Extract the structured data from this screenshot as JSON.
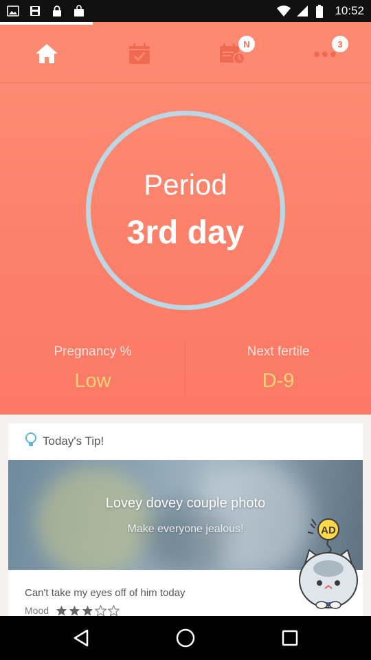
{
  "status_bar": {
    "time": "10:52",
    "left_icons": [
      "image-icon",
      "save-icon",
      "lock-icon",
      "bag-icon"
    ],
    "right_icons": [
      "wifi-icon",
      "signal-icon",
      "battery-icon"
    ]
  },
  "tabs": [
    {
      "name": "home",
      "icon": "home-icon",
      "active": true,
      "badge": ""
    },
    {
      "name": "calendar",
      "icon": "calendar-check-icon",
      "active": false,
      "badge": ""
    },
    {
      "name": "schedule",
      "icon": "calendar-clock-icon",
      "active": false,
      "badge": "N"
    },
    {
      "name": "more",
      "icon": "more-icon",
      "active": false,
      "badge": "3"
    }
  ],
  "hero": {
    "status_title": "Period",
    "status_day": "3rd day",
    "pregnancy_label": "Pregnancy %",
    "pregnancy_value": "Low",
    "fertile_label": "Next fertile",
    "fertile_value": "D-9"
  },
  "tip": {
    "header": "Today's Tip!",
    "photo_title": "Lovey dovey couple photo",
    "photo_subtitle": "Make everyone jealous!",
    "post_text": "Can't take my eyes off of him today",
    "mood_label": "Mood",
    "mood_rating": 3,
    "mood_max": 5,
    "ad_badge": "AD"
  },
  "colors": {
    "accent": "#fd8a70",
    "ring": "#bcd6e3",
    "highlight": "#ffd27a"
  }
}
